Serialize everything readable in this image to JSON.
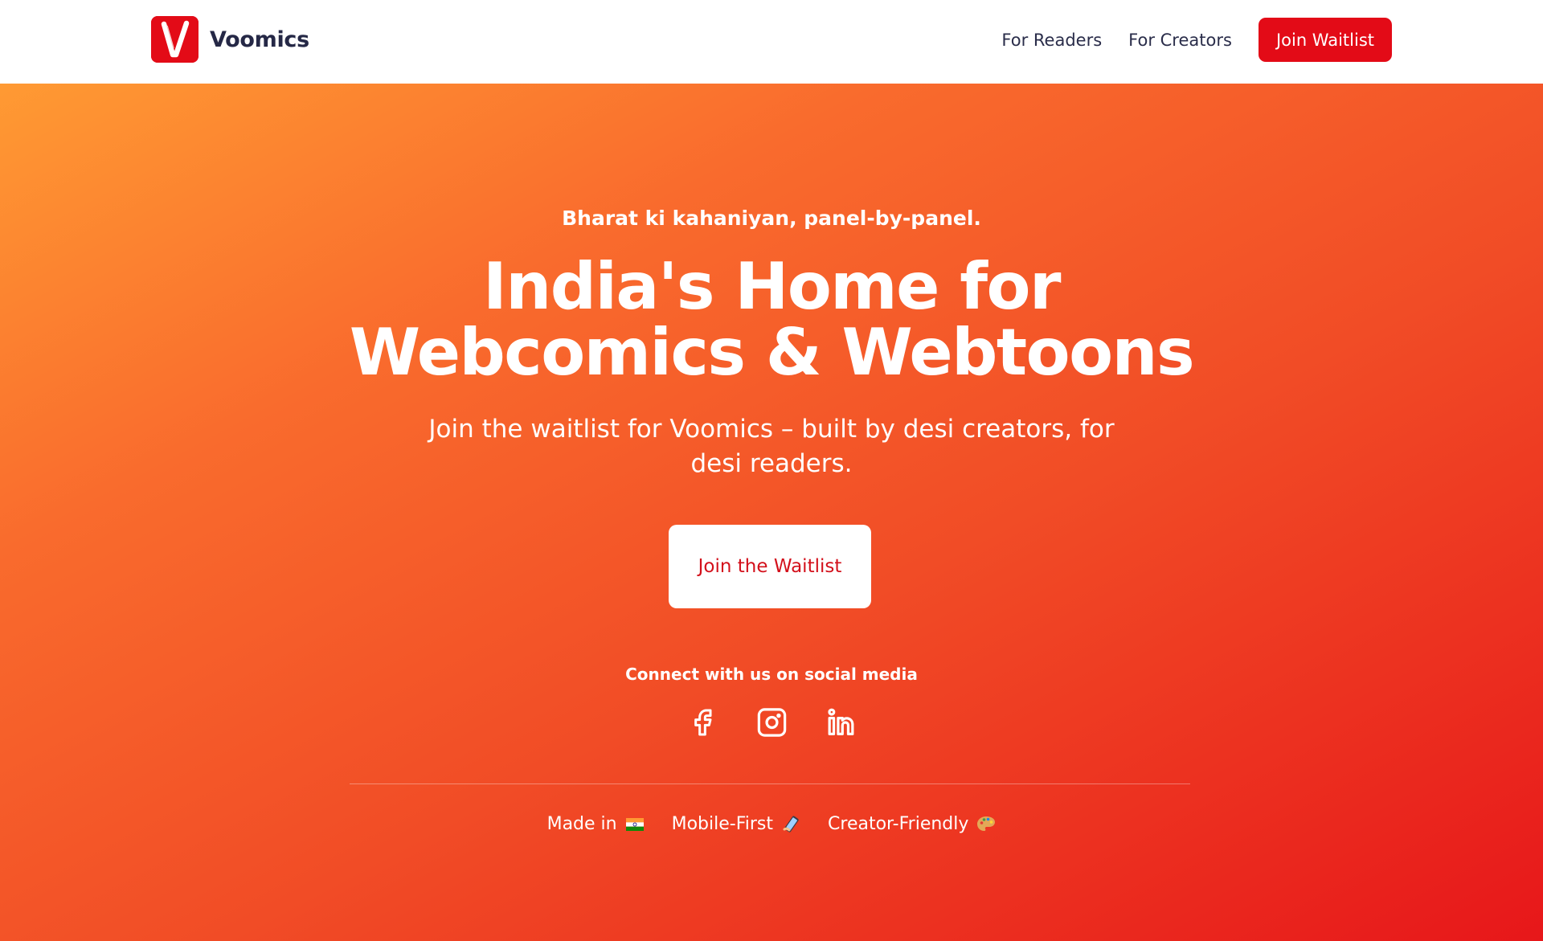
{
  "nav": {
    "brand_name": "Voomics",
    "links": [
      {
        "label": "For Readers"
      },
      {
        "label": "For Creators"
      }
    ],
    "cta_label": "Join Waitlist"
  },
  "hero": {
    "tagline": "Bharat ki kahaniyan, panel-by-panel.",
    "headline_line1": "India's Home for",
    "headline_line2": "Webcomics & Webtoons",
    "subtitle": "Join the waitlist for Voomics – built by desi creators, for desi readers.",
    "cta_label": "Join the Waitlist"
  },
  "social": {
    "heading": "Connect with us on social media",
    "icons": [
      "facebook-icon",
      "instagram-icon",
      "linkedin-icon"
    ]
  },
  "features": [
    {
      "label": "Made in",
      "icon": "india-flag-icon"
    },
    {
      "label": "Mobile-First",
      "icon": "mobile-phone-icon"
    },
    {
      "label": "Creator-Friendly",
      "icon": "artist-palette-icon"
    }
  ],
  "colors": {
    "brand_red": "#e30b17",
    "nav_text": "#2a2d4a",
    "gradient_start": "#ff9a33",
    "gradient_end": "#e7171a",
    "hero_cta_text": "#d3101b"
  }
}
